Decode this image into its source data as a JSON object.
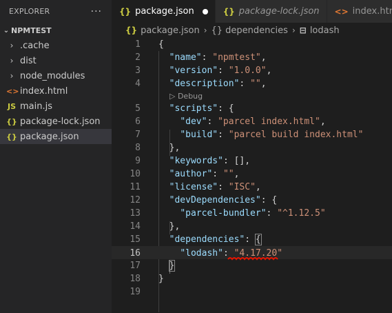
{
  "explorer": {
    "title": "EXPLORER",
    "more_icon": "···",
    "project": "NPMTEST",
    "project_chevron": "⌄",
    "items": [
      {
        "label": ".cache",
        "icon": "›",
        "kind": "folder"
      },
      {
        "label": "dist",
        "icon": "›",
        "kind": "folder"
      },
      {
        "label": "node_modules",
        "icon": "›",
        "kind": "folder"
      },
      {
        "label": "index.html",
        "icon": "<>",
        "kind": "html",
        "color": "#e37933"
      },
      {
        "label": "main.js",
        "icon": "JS",
        "kind": "js",
        "color": "#cbcb41"
      },
      {
        "label": "package-lock.json",
        "icon": "{}",
        "kind": "json",
        "color": "#cbcb41"
      },
      {
        "label": "package.json",
        "icon": "{}",
        "kind": "json",
        "color": "#cbcb41",
        "selected": true
      }
    ]
  },
  "tabs": [
    {
      "label": "package.json",
      "icon": "{}",
      "active": true,
      "dirty": true
    },
    {
      "label": "package-lock.json",
      "icon": "{}",
      "italic": true
    },
    {
      "label": "index.html",
      "icon": "<>"
    }
  ],
  "breadcrumb": {
    "file": "package.json",
    "file_icon": "{}",
    "sep": "›",
    "part2": "{} dependencies",
    "part3_icon": "⊟",
    "part3": "lodash"
  },
  "codelens": "▷ Debug",
  "lines": [
    {
      "n": "1",
      "parts": [
        [
          "p",
          "{"
        ]
      ]
    },
    {
      "n": "2",
      "parts": [
        [
          "p",
          "  "
        ],
        [
          "k",
          "\"name\""
        ],
        [
          "p",
          ": "
        ],
        [
          "s",
          "\"npmtest\""
        ],
        [
          "p",
          ","
        ]
      ]
    },
    {
      "n": "3",
      "parts": [
        [
          "p",
          "  "
        ],
        [
          "k",
          "\"version\""
        ],
        [
          "p",
          ": "
        ],
        [
          "s",
          "\"1.0.0\""
        ],
        [
          "p",
          ","
        ]
      ]
    },
    {
      "n": "4",
      "parts": [
        [
          "p",
          "  "
        ],
        [
          "k",
          "\"description\""
        ],
        [
          "p",
          ": "
        ],
        [
          "s",
          "\"\""
        ],
        [
          "p",
          ","
        ]
      ]
    },
    {
      "n": "5",
      "parts": [
        [
          "p",
          "  "
        ],
        [
          "k",
          "\"scripts\""
        ],
        [
          "p",
          ": {"
        ]
      ]
    },
    {
      "n": "6",
      "parts": [
        [
          "p",
          "    "
        ],
        [
          "k",
          "\"dev\""
        ],
        [
          "p",
          ": "
        ],
        [
          "s",
          "\"parcel index.html\""
        ],
        [
          "p",
          ","
        ]
      ]
    },
    {
      "n": "7",
      "parts": [
        [
          "p",
          "    "
        ],
        [
          "k",
          "\"build\""
        ],
        [
          "p",
          ": "
        ],
        [
          "s",
          "\"parcel build index.html\""
        ]
      ]
    },
    {
      "n": "8",
      "parts": [
        [
          "p",
          "  },"
        ]
      ]
    },
    {
      "n": "9",
      "parts": [
        [
          "p",
          "  "
        ],
        [
          "k",
          "\"keywords\""
        ],
        [
          "p",
          ": [],"
        ]
      ]
    },
    {
      "n": "10",
      "parts": [
        [
          "p",
          "  "
        ],
        [
          "k",
          "\"author\""
        ],
        [
          "p",
          ": "
        ],
        [
          "s",
          "\"\""
        ],
        [
          "p",
          ","
        ]
      ]
    },
    {
      "n": "11",
      "parts": [
        [
          "p",
          "  "
        ],
        [
          "k",
          "\"license\""
        ],
        [
          "p",
          ": "
        ],
        [
          "s",
          "\"ISC\""
        ],
        [
          "p",
          ","
        ]
      ]
    },
    {
      "n": "12",
      "parts": [
        [
          "p",
          "  "
        ],
        [
          "k",
          "\"devDependencies\""
        ],
        [
          "p",
          ": {"
        ]
      ]
    },
    {
      "n": "13",
      "parts": [
        [
          "p",
          "    "
        ],
        [
          "k",
          "\"parcel-bundler\""
        ],
        [
          "p",
          ": "
        ],
        [
          "s",
          "\"^1.12.5\""
        ]
      ]
    },
    {
      "n": "14",
      "parts": [
        [
          "p",
          "  },"
        ]
      ]
    },
    {
      "n": "15",
      "parts": [
        [
          "p",
          "  "
        ],
        [
          "k",
          "\"dependencies\""
        ],
        [
          "p",
          ": "
        ],
        [
          "bm",
          "{"
        ]
      ]
    },
    {
      "n": "16",
      "parts": [
        [
          "p",
          "    "
        ],
        [
          "k",
          "\"lodash\""
        ],
        [
          "p",
          ": "
        ],
        [
          "s",
          "\"4.17.20\""
        ]
      ],
      "current": true
    },
    {
      "n": "17",
      "parts": [
        [
          "p",
          "  "
        ],
        [
          "bm",
          "}"
        ]
      ]
    },
    {
      "n": "18",
      "parts": [
        [
          "p",
          "}"
        ]
      ]
    },
    {
      "n": "19",
      "parts": []
    }
  ],
  "colors": {
    "squiggle": "#e51400"
  }
}
